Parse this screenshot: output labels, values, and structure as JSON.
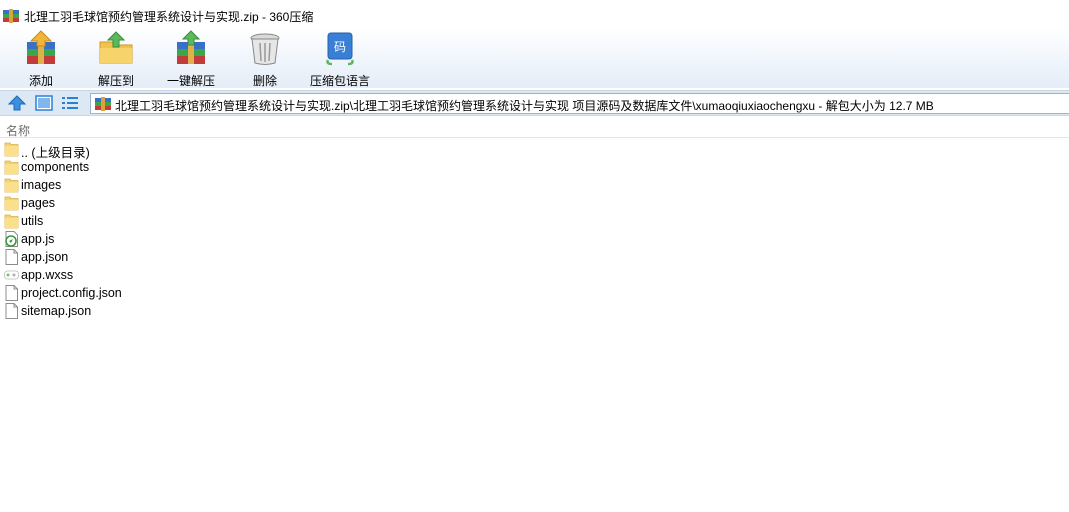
{
  "window": {
    "title": "北理工羽毛球馆预约管理系统设计与实现.zip - 360压缩"
  },
  "toolbar": {
    "items": [
      {
        "label": "添加",
        "icon": "add-archive-icon"
      },
      {
        "label": "解压到",
        "icon": "extract-to-icon"
      },
      {
        "label": "一键解压",
        "icon": "one-click-extract-icon"
      },
      {
        "label": "删除",
        "icon": "delete-trash-icon"
      },
      {
        "label": "压缩包语言",
        "icon": "archive-language-icon"
      }
    ]
  },
  "nav": {
    "address": "北理工羽毛球馆预约管理系统设计与实现.zip\\北理工羽毛球馆预约管理系统设计与实现 项目源码及数据库文件\\xumaoqiuxiaochengxu - 解包大小为 12.7 MB"
  },
  "list": {
    "column_name": "名称",
    "rows": [
      {
        "name": ".. (上级目录)",
        "icon": "folder-icon"
      },
      {
        "name": "components",
        "icon": "folder-icon"
      },
      {
        "name": "images",
        "icon": "folder-icon"
      },
      {
        "name": "pages",
        "icon": "folder-icon"
      },
      {
        "name": "utils",
        "icon": "folder-icon"
      },
      {
        "name": "app.js",
        "icon": "js-file-icon"
      },
      {
        "name": "app.json",
        "icon": "file-icon"
      },
      {
        "name": "app.wxss",
        "icon": "wxss-file-icon"
      },
      {
        "name": "project.config.json",
        "icon": "file-icon"
      },
      {
        "name": "sitemap.json",
        "icon": "file-icon"
      }
    ]
  },
  "colors": {
    "toolbar_gradient_bottom": "#e4edf8",
    "navbar_bg": "#dde8f5",
    "folder_yellow": "#f5d271",
    "accent_blue": "#2a7fd6"
  }
}
